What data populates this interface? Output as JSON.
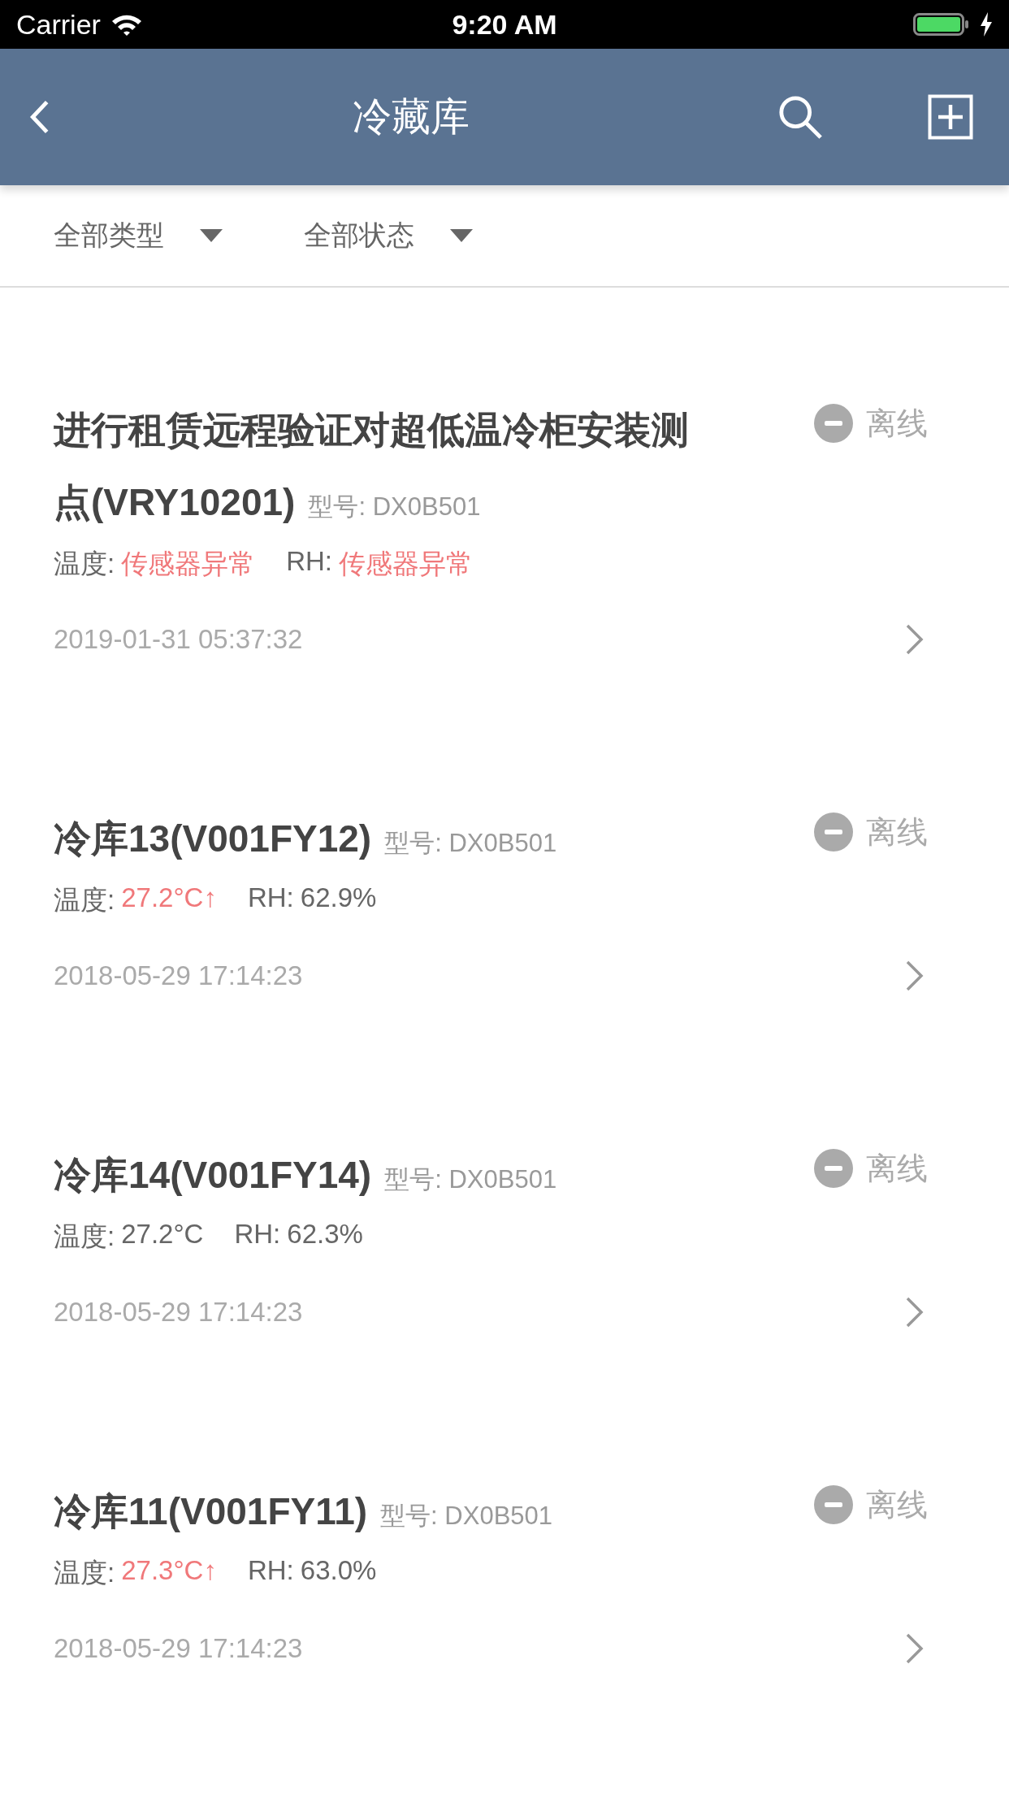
{
  "status_bar": {
    "carrier": "Carrier",
    "time": "9:20 AM"
  },
  "nav": {
    "title": "冷藏库"
  },
  "filters": [
    {
      "label": "全部类型"
    },
    {
      "label": "全部状态"
    }
  ],
  "devices": [
    {
      "name": "进行租赁远程验证对超低温冷柜安装测点(VRY10201)",
      "model": "型号: DX0B501",
      "status": {
        "text": "离线",
        "kind": "offline"
      },
      "temperature": {
        "label": "温度:",
        "value": "传感器异常",
        "alert": true
      },
      "humidity": {
        "label": "RH:",
        "value": "传感器异常",
        "alert": true
      },
      "time": "2019-01-31 05:37:32"
    },
    {
      "name": "冷库13(V001FY12)",
      "model": "型号: DX0B501",
      "status": {
        "text": "离线",
        "kind": "offline"
      },
      "temperature": {
        "label": "温度:",
        "value": "27.2°C↑",
        "alert": true
      },
      "humidity": {
        "label": "RH:",
        "value": "62.9%",
        "alert": false
      },
      "time": "2018-05-29 17:14:23"
    },
    {
      "name": "冷库14(V001FY14)",
      "model": "型号: DX0B501",
      "status": {
        "text": "离线",
        "kind": "offline"
      },
      "temperature": {
        "label": "温度:",
        "value": "27.2°C",
        "alert": false
      },
      "humidity": {
        "label": "RH:",
        "value": "62.3%",
        "alert": false
      },
      "time": "2018-05-29 17:14:23"
    },
    {
      "name": "冷库11(V001FY11)",
      "model": "型号: DX0B501",
      "status": {
        "text": "离线",
        "kind": "offline"
      },
      "temperature": {
        "label": "温度:",
        "value": "27.3°C↑",
        "alert": true
      },
      "humidity": {
        "label": "RH:",
        "value": "63.0%",
        "alert": false
      },
      "time": "2018-05-29 17:14:23"
    }
  ]
}
